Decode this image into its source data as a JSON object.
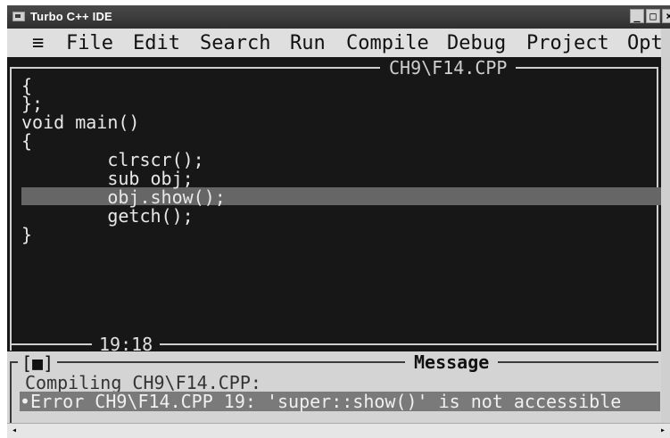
{
  "window": {
    "title": "Turbo C++ IDE",
    "buttons": [
      "_",
      "□",
      "×"
    ]
  },
  "menu": {
    "sys": "≡",
    "items": [
      "File",
      "Edit",
      "Search",
      "Run",
      "Compile",
      "Debug",
      "Project",
      "Opt"
    ]
  },
  "editor": {
    "file_title": "CH9\\F14.CPP",
    "lines": [
      "{",
      "};",
      "void main()",
      "{",
      "        clrscr();",
      "        sub obj;",
      "        obj.show();",
      "        getch();",
      "}"
    ],
    "cursor_position": "19:18",
    "highlighted_line_index": 6
  },
  "message_window": {
    "close_box": "[■]",
    "title": "Message",
    "lines": [
      "Compiling CH9\\F14.CPP:",
      "•Error CH9\\F14.CPP 19: 'super::show()' is not accessible"
    ]
  },
  "colors": {
    "editor_bg": "#171717",
    "highlight": "#666666",
    "message_bg": "#d4d4d4"
  }
}
